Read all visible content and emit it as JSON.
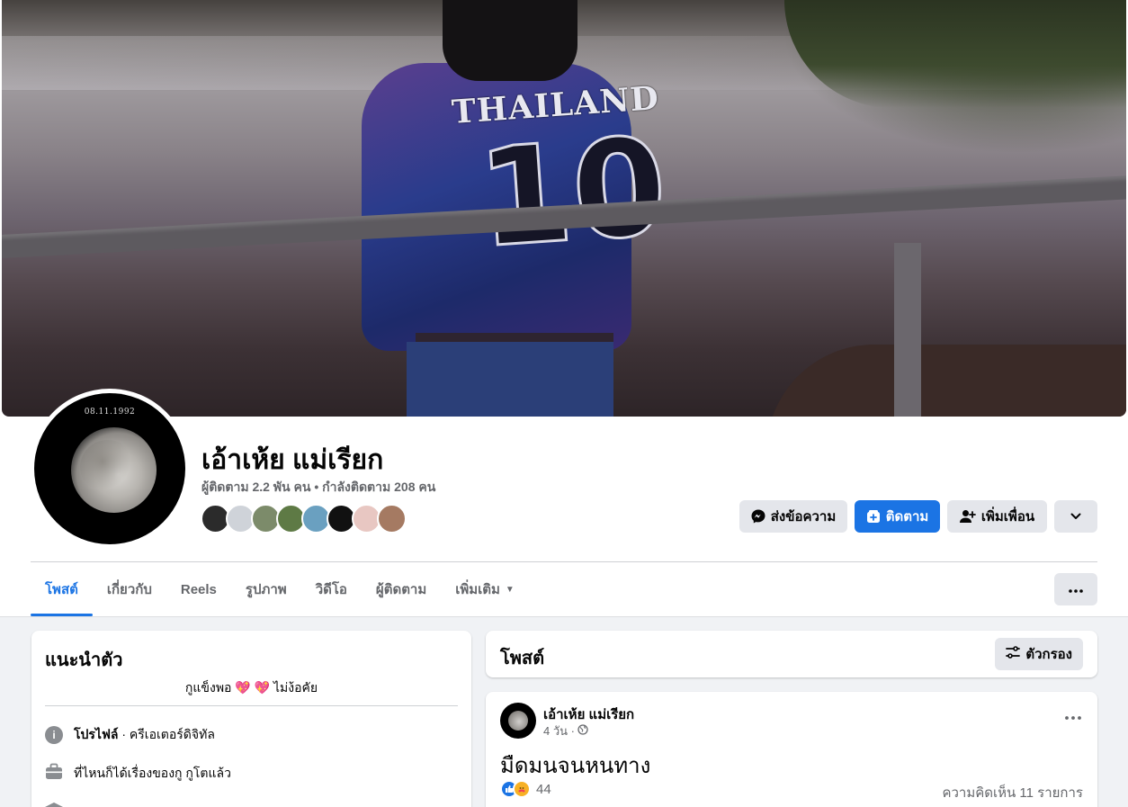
{
  "profile": {
    "avatar_date": "08.11.1992",
    "name": "เอ้าเห้ย แม่เรียก",
    "followers": "ผู้ติดตาม 2.2 พัน คน",
    "separator": "•",
    "following": "กำลังติดตาม 208 คน"
  },
  "friend_avatars": [
    "#2b2b2b",
    "#cfd3d9",
    "#7c8b6a",
    "#5e7a45",
    "#6aa0c0",
    "#111111",
    "#e8c7c2",
    "#a57a62"
  ],
  "actions": {
    "message_label": "ส่งข้อความ",
    "follow_label": "ติดตาม",
    "add_friend_label": "เพิ่มเพื่อน"
  },
  "tabs": [
    {
      "label": "โพสต์",
      "active": true
    },
    {
      "label": "เกี่ยวกับ"
    },
    {
      "label": "Reels"
    },
    {
      "label": "รูปภาพ"
    },
    {
      "label": "วิดีโอ"
    },
    {
      "label": "ผู้ติดตาม"
    },
    {
      "label": "เพิ่มเติม"
    }
  ],
  "intro": {
    "title": "แนะนำตัว",
    "bio_left": "กูแข็งพอ",
    "bio_hearts": "💖 💖",
    "bio_right": "ไม่ง้อคัย",
    "profile_label": "โปรไฟล์",
    "profile_type": " · ครีเอเตอร์ดิจิทัล",
    "work": "ที่ไหนก็ได้เรื่องของกู กูโตแล้ว"
  },
  "posts_section": {
    "title": "โพสต์",
    "filter_label": "ตัวกรอง"
  },
  "post": {
    "author": "เอ้าเห้ย แม่เรียก",
    "time": "4 วัน ·",
    "text": "มืดมนจนหนทาง",
    "reaction_count": "44",
    "comment_count": "ความคิดเห็น 11 รายการ"
  },
  "colors": {
    "accent": "#1b74e4",
    "button_grey": "#e4e6eb",
    "background": "#f0f2f5"
  }
}
